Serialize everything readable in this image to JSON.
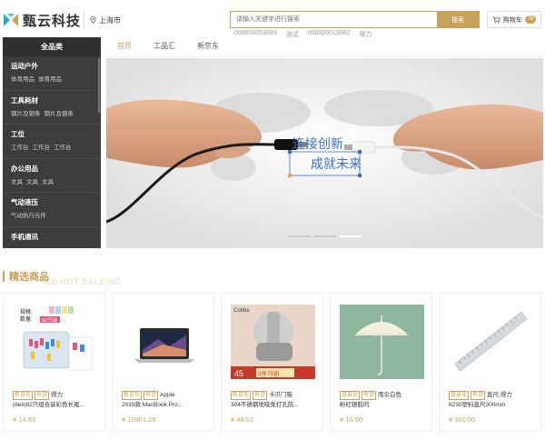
{
  "brand": {
    "name": "甄云科技",
    "location": "上海市"
  },
  "search": {
    "placeholder": "请输入关键字进行搜索",
    "button": "搜索",
    "hotwords": [
      "000000003893",
      "测试",
      "000000013682",
      "得力"
    ]
  },
  "cart": {
    "label": "购物车",
    "count": "78"
  },
  "nav": [
    "首页",
    "工品汇",
    "新京东"
  ],
  "sidebar": {
    "header": "全品类",
    "categories": [
      {
        "title": "运动户外",
        "subs": [
          "体育用品",
          "体育用品"
        ]
      },
      {
        "title": "工具耗材",
        "subs": [
          "钢片及钢条",
          "钢片及钢条"
        ]
      },
      {
        "title": "工位",
        "subs": [
          "工作台",
          "工作台",
          "工作台"
        ]
      },
      {
        "title": "办公用品",
        "subs": [
          "文具",
          "文具",
          "文具"
        ]
      },
      {
        "title": "气动液压",
        "subs": [
          "气动执行元件"
        ]
      },
      {
        "title": "手机通讯",
        "subs": []
      }
    ]
  },
  "banner": {
    "line1": "连接创新",
    "line2": "成就未来"
  },
  "section": {
    "title": "精选商品",
    "subtitle": "TED HOT SALEING"
  },
  "products": [
    {
      "tags": [
        "新京东",
        "有货"
      ],
      "name1": "得力",
      "name2": "(deli)82只组合装彩色长尾...",
      "price": "¥ 14.93",
      "img_text1": "规格:",
      "img_text2": "数量:",
      "img_badge": "82只装"
    },
    {
      "tags": [
        "新京东",
        "有货"
      ],
      "name1": "Apple",
      "name2": "2019款 MacBook Pro...",
      "price": "¥ 10901.28"
    },
    {
      "tags": [
        "新京东",
        "有货"
      ],
      "name1": "卡贝门吸",
      "name2": "304不锈钢地吸免打孔防...",
      "price": "¥ 48.53",
      "img_brand": "Cobbe",
      "img_num": "45",
      "img_badge": "3件75折"
    },
    {
      "tags": [
        "目录化",
        "有货"
      ],
      "name1": "雨伞白色",
      "name2": "粉红银胶的",
      "price": "¥ 10.00"
    },
    {
      "tags": [
        "目录化",
        "有货"
      ],
      "name1": "直尺,得力",
      "name2": "6230塑料直尺300mm",
      "price": "¥ 300.00"
    }
  ],
  "colors": {
    "accent": "#c9a25a",
    "sidebar": "#3d3d3d"
  }
}
